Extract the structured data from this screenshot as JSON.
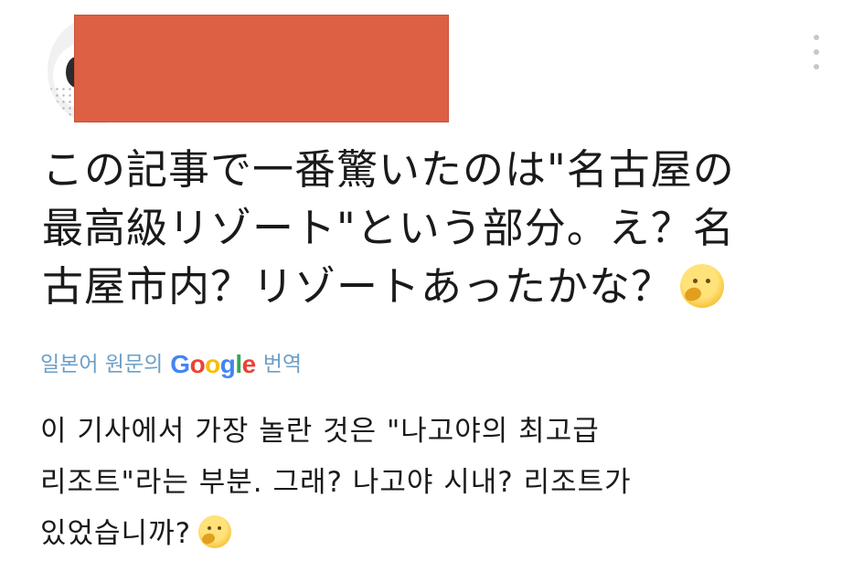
{
  "post": {
    "text_lines": [
      "この記事で一番驚いたのは\"名古屋の",
      "最高級リゾート\"という部分。え？名",
      "古屋市内？リゾートあったかな？"
    ],
    "emoji": "thinking-face"
  },
  "translation": {
    "prefix": "일본어 원문의",
    "brand_letters": [
      "G",
      "o",
      "o",
      "g",
      "l",
      "e"
    ],
    "brand_colors": [
      "#4285F4",
      "#EA4335",
      "#FBBC05",
      "#4285F4",
      "#34A853",
      "#EA4335"
    ],
    "suffix": "번역",
    "link_color": "#6d9fc6"
  },
  "translated": {
    "text_lines": [
      "이 기사에서 가장 놀란 것은 \"나고야의 최고급",
      "리조트\"라는 부분. 그래? 나고야 시내? 리조트가",
      "있었습니까?"
    ],
    "emoji": "thinking-face"
  },
  "header": {
    "redaction_color": "#dd6044",
    "more_icon": "more-vertical-icon"
  }
}
